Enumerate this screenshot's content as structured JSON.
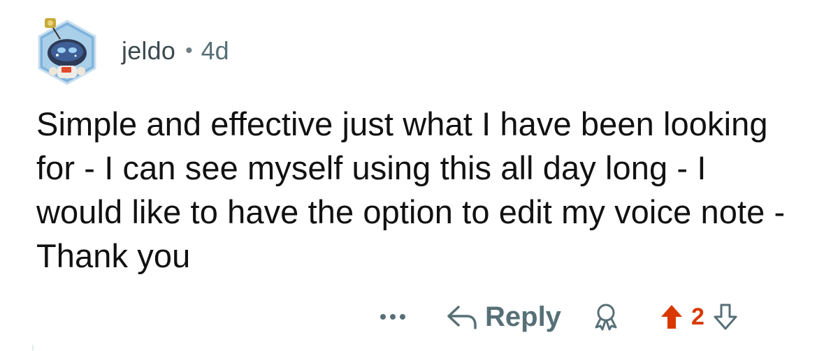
{
  "comment": {
    "author": "jeldo",
    "separator": "•",
    "age": "4d",
    "text": "Simple and effective just what I have been looking for - I can see myself using this all day long - I would like to have the option to edit my voice note - Thank you",
    "actions": {
      "reply_label": "Reply",
      "vote_count": "2",
      "more_label": "•••"
    }
  },
  "colors": {
    "upvote_active": "#d93900",
    "muted": "#576f76"
  },
  "icons": {
    "avatar": "snoo-avatar",
    "more": "more-options-icon",
    "reply": "reply-arrow-icon",
    "award": "award-icon",
    "upvote": "upvote-arrow-icon",
    "downvote": "downvote-arrow-icon"
  }
}
